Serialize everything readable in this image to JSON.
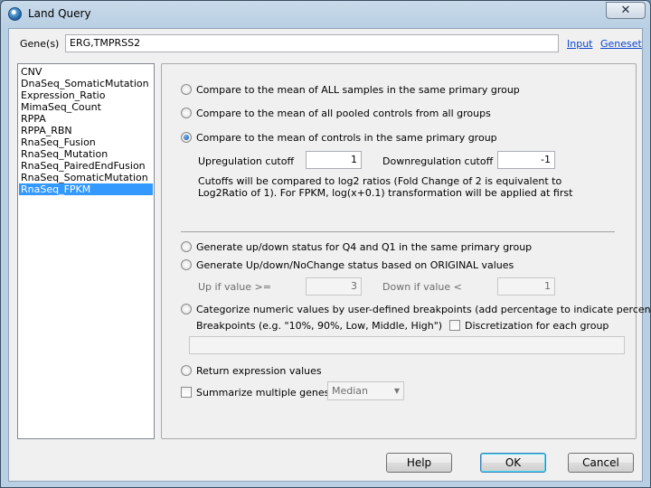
{
  "window": {
    "title": "Land Query",
    "close_glyph": "✕"
  },
  "genes": {
    "label": "Gene(s)",
    "value": "ERG,TMPRSS2",
    "input_link": "Input",
    "geneset_link": "Geneset"
  },
  "datasets": {
    "items": [
      "CNV",
      "DnaSeq_SomaticMutation",
      "Expression_Ratio",
      "MimaSeq_Count",
      "RPPA",
      "RPPA_RBN",
      "RnaSeq_Fusion",
      "RnaSeq_Mutation",
      "RnaSeq_PairedEndFusion",
      "RnaSeq_SomaticMutation",
      "RnaSeq_FPKM"
    ],
    "selected": "RnaSeq_FPKM"
  },
  "options": {
    "mean_all": "Compare to the mean of ALL samples in the same primary group",
    "mean_pooled": "Compare to the mean of all pooled controls from all groups",
    "mean_controls": "Compare to the mean of controls in the same primary group",
    "up_cutoff_label": "Upregulation cutoff",
    "up_cutoff_value": "1",
    "down_cutoff_label": "Downregulation cutoff",
    "down_cutoff_value": "-1",
    "cutoff_note_1": "Cutoffs will be compared to log2 ratios (Fold Change of 2 is equivalent to",
    "cutoff_note_2": "Log2Ratio of 1). For FPKM, log(x+0.1) transformation will be applied at first",
    "q4q1": "Generate up/down status for Q4 and Q1 in the same primary group",
    "original": "Generate Up/down/NoChange status based on ORIGINAL values",
    "up_if_label": "Up if value >=",
    "up_if_value": "3",
    "down_if_label": "Down if value <",
    "down_if_value": "1",
    "categorize": "Categorize numeric values by user-defined breakpoints (add percentage to indicate percentiles)",
    "breakpoints_label": "Breakpoints (e.g. \"10%, 90%, Low, Middle, High\")",
    "discretization_label": "Discretization for each group",
    "breakpoints_value": "",
    "return_expr": "Return expression values",
    "summarize_label": "Summarize multiple genes by",
    "summarize_value": "Median",
    "selected_option": "mean_controls"
  },
  "buttons": {
    "help": "Help",
    "ok": "OK",
    "cancel": "Cancel"
  },
  "colors": {
    "selection": "#3399ff",
    "link": "#0a44cc"
  }
}
